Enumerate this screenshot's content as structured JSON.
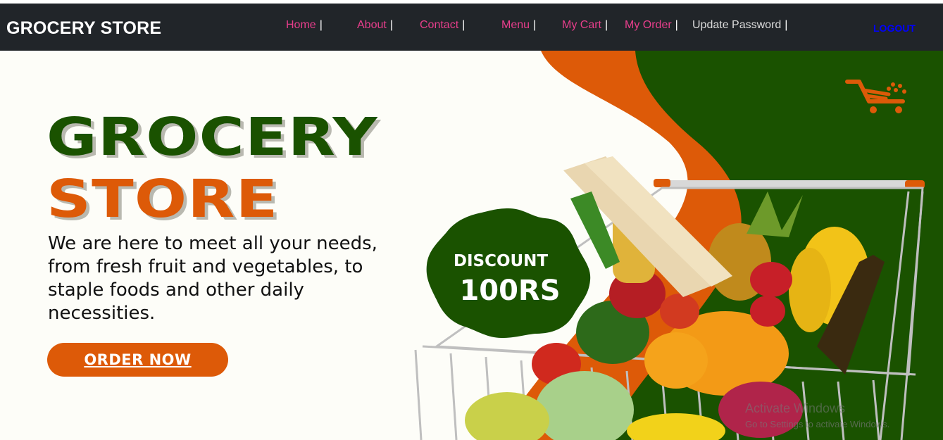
{
  "navbar": {
    "brand": "GROCERY STORE",
    "links": [
      {
        "label": "Home",
        "sep": "|"
      },
      {
        "label": "About",
        "sep": "|"
      },
      {
        "label": "Contact",
        "sep": "|"
      },
      {
        "label": "Menu",
        "sep": "|"
      },
      {
        "label": "My Cart",
        "sep": "|"
      },
      {
        "label": "My Order",
        "sep": "|"
      },
      {
        "label": "Update Password",
        "sep": "|"
      }
    ],
    "logout": "LOGOUT"
  },
  "hero": {
    "title_line1": "GROCERY",
    "title_line2": "STORE",
    "description": "We are here to meet all your needs, from fresh fruit and vegetables, to staple foods and other daily necessities.",
    "order_button": "ORDER NOW",
    "badge_line1": "DISCOUNT",
    "badge_line2": "100RS",
    "cart_icon": "shopping-cart-icon"
  },
  "watermark": {
    "line1": "Activate Windows",
    "line2": "Go to Settings to activate Windows."
  },
  "colors": {
    "navbar_bg": "#212529",
    "link_color": "#e83e8c",
    "logout_color": "#0000ff",
    "green": "#1a5200",
    "orange": "#dd5a08",
    "hero_bg": "#fdfdf8"
  }
}
